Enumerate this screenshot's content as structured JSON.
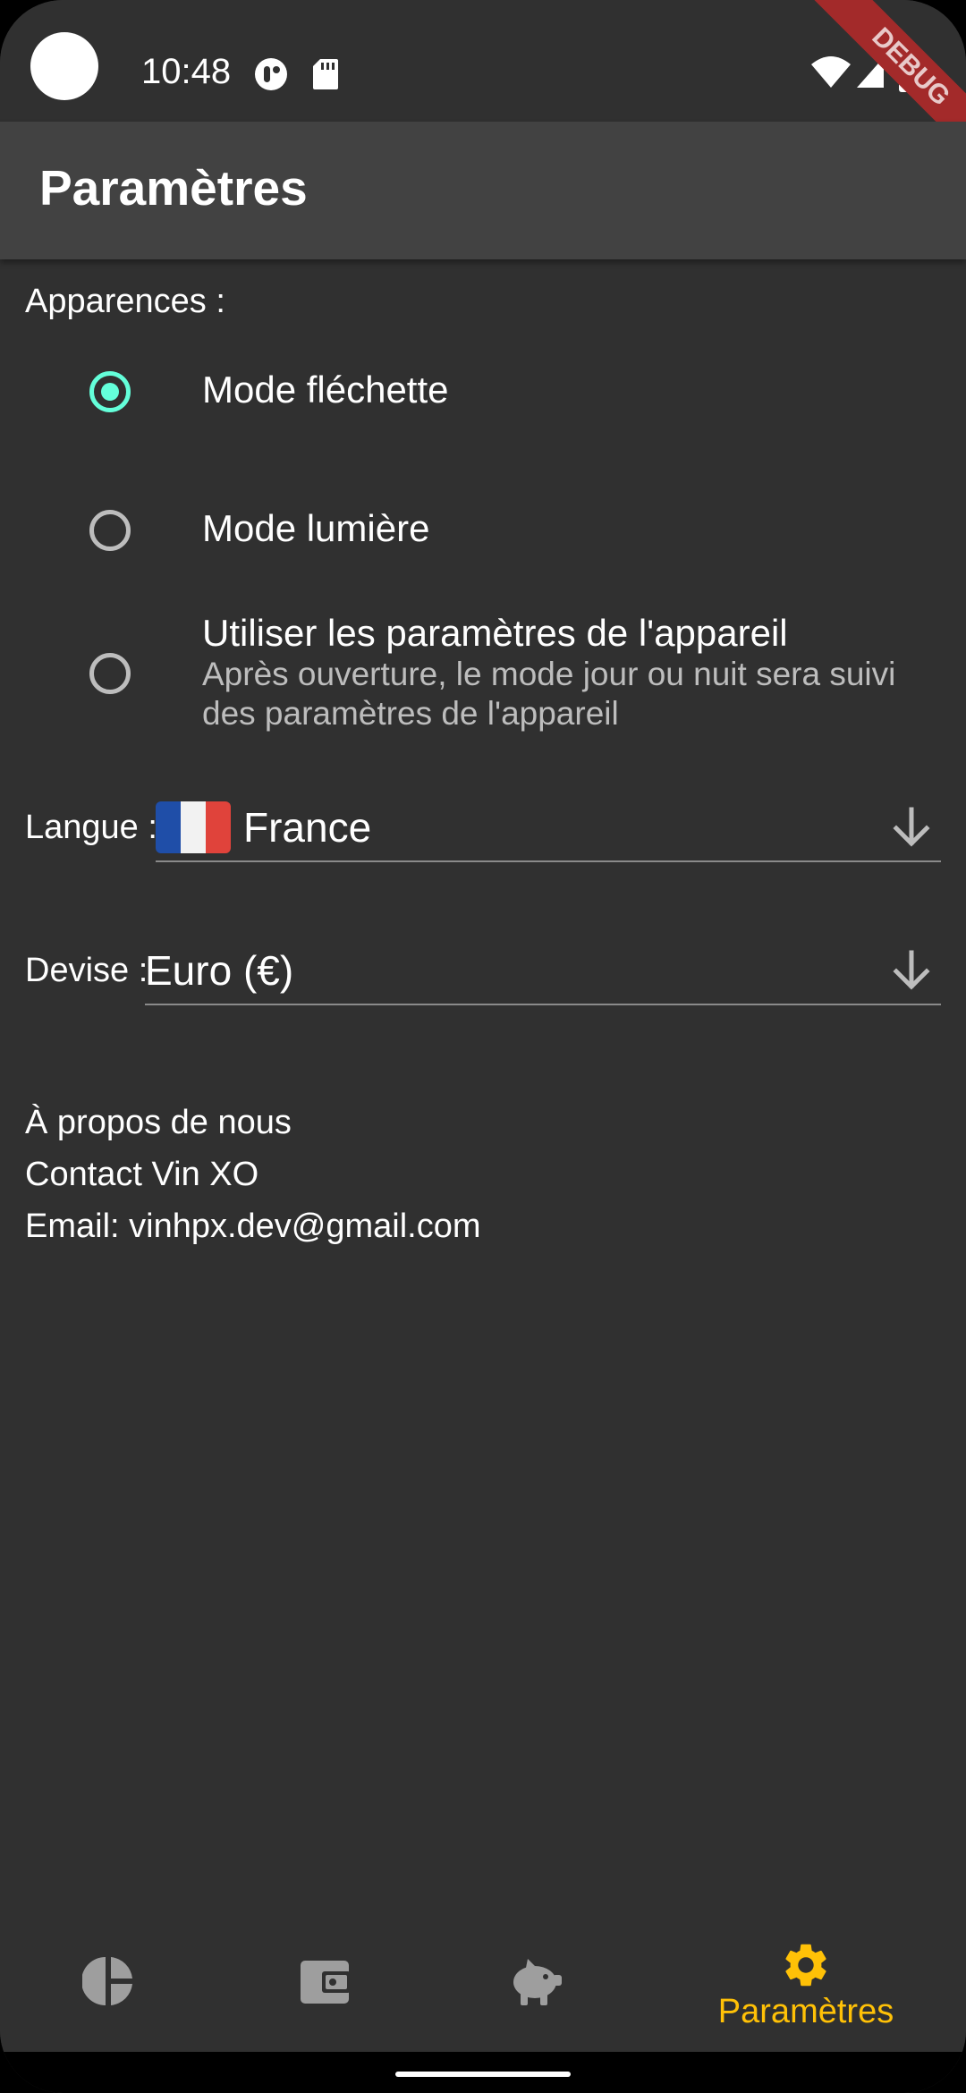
{
  "status_bar": {
    "time": "10:48",
    "icons": [
      "camera-cutout",
      "assistant-icon",
      "sd-card-icon",
      "wifi-icon",
      "signal-icon",
      "battery-icon"
    ],
    "debug_banner": "DEBUG"
  },
  "app_bar": {
    "title": "Paramètres"
  },
  "appearance": {
    "label": "Apparences :",
    "options": [
      {
        "title": "Mode fléchette",
        "selected": true
      },
      {
        "title": "Mode lumière",
        "selected": false
      },
      {
        "title": "Utiliser les paramètres de l'appareil",
        "subtitle": "Après ouverture, le mode jour ou nuit sera suivi des paramètres de l'appareil",
        "selected": false
      }
    ],
    "accent_color": "#64ffda"
  },
  "language": {
    "label": "Langue :",
    "value": "France",
    "flag_icon": "france-flag-icon"
  },
  "currency": {
    "label": "Devise :",
    "value": "Euro (€)"
  },
  "about": {
    "title": "À propos de nous",
    "contact": "Contact Vin XO",
    "email": "Email: vinhpx.dev@gmail.com"
  },
  "bottom_nav": {
    "items": [
      {
        "icon": "pie-chart-icon",
        "label": ""
      },
      {
        "icon": "wallet-icon",
        "label": ""
      },
      {
        "icon": "piggy-bank-icon",
        "label": ""
      },
      {
        "icon": "gear-icon",
        "label": "Paramètres",
        "active": true
      }
    ],
    "active_color": "#ffc107",
    "inactive_color": "#9e9e9e"
  }
}
